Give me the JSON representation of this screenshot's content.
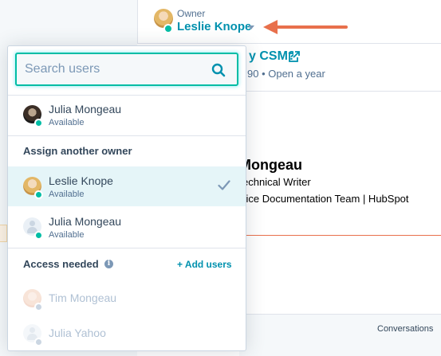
{
  "owner": {
    "label": "Owner",
    "name": "Leslie Knope"
  },
  "background": {
    "csm_title": "y CSM?",
    "csm_subtitle": "90 • Open a year",
    "contact_name": "Mongeau",
    "contact_role": "echnical Writer",
    "contact_team": "vice Documentation Team | HubSpot",
    "conversations_tab": "Conversations"
  },
  "dropdown": {
    "search": {
      "placeholder": "Search users",
      "value": ""
    },
    "current_owner": {
      "name": "Julia Mongeau",
      "status": "Available"
    },
    "assign_heading": "Assign another owner",
    "owners": [
      {
        "name": "Leslie Knope",
        "status": "Available",
        "selected": true
      },
      {
        "name": "Julia Mongeau",
        "status": "Available",
        "selected": false
      }
    ],
    "access_heading": "Access needed",
    "add_users_label": "+ Add users",
    "no_access_users": [
      {
        "name": "Tim Mongeau"
      },
      {
        "name": "Julia Yahoo"
      }
    ]
  },
  "colors": {
    "accent": "#0091ae",
    "focus": "#00bda5",
    "arrow": "#e8704c",
    "selected_row": "#e5f5f8"
  }
}
